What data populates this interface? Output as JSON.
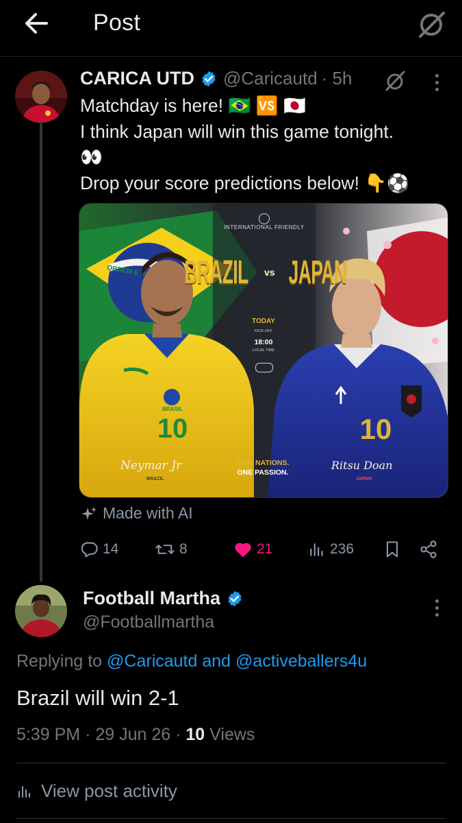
{
  "header": {
    "title": "Post"
  },
  "tweet": {
    "author_name": "CARICA UTD",
    "handle": "@Caricautd",
    "time": "· 5h",
    "lines": [
      "Matchday is here! 🇧🇷 🆚 🇯🇵",
      "I think Japan will win this game tonight.",
      "👀",
      "Drop your score predictions below! 👇⚽"
    ],
    "media": {
      "top_label": "INTERNATIONAL FRIENDLY",
      "team_left": "BRAZIL",
      "vs": "vs",
      "team_right": "JAPAN",
      "day": "TODAY",
      "kickoff_label": "KICK-OFF",
      "kickoff_time": "18:00",
      "time_note": "LOCAL TIME",
      "tagline_1": "TWO NATIONS.",
      "tagline_2": "ONE PASSION.",
      "left_player_signature": "Neymar Jr",
      "left_player_country": "BRAZIL",
      "left_shirt_text": "BRASIL",
      "left_number": "10",
      "right_player_signature": "Ritsu Doan",
      "right_player_country": "JAPAN",
      "right_number": "10",
      "flag_text": "ORDEM E P"
    },
    "ai_label": "Made with AI",
    "stats": {
      "replies": "14",
      "reposts": "8",
      "likes": "21",
      "views": "236"
    },
    "colors": {
      "like": "#f91880",
      "verified": "#1d9bf0"
    }
  },
  "reply": {
    "author_name": "Football Martha",
    "handle": "@Footballmartha",
    "replying_prefix": "Replying to",
    "replying_handle_1": "@Caricautd",
    "replying_and": "and",
    "replying_handle_2": "@activeballers4u",
    "text": "Brazil will win 2-1",
    "time": "5:39 PM",
    "date": "29 Jun 26",
    "views_count": "10",
    "views_label": "Views"
  },
  "footer": {
    "activity_label": "View post activity"
  }
}
